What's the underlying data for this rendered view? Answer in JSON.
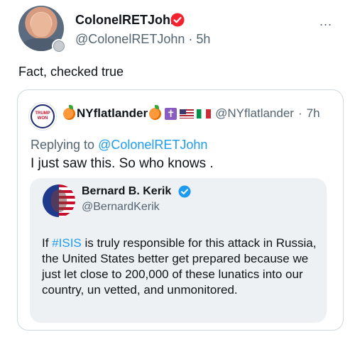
{
  "author": {
    "display_name": "ColonelRETJohn",
    "handle": "@ColonelRETJohn",
    "time": "5h",
    "verified_icon_color": "#f4212e",
    "more_icon": "..."
  },
  "tweet": {
    "text": "Fact, checked true"
  },
  "quoted": {
    "avatar_text": "TRUMP WON",
    "display_name": "NYflatlander",
    "cross_glyph": "✝",
    "handle": "@NYflatlander",
    "time": "7h",
    "replying_prefix": "Replying to",
    "replying_mention": "@ColonelRETJohn",
    "text": "I just saw this. So who knows ."
  },
  "nested_quote": {
    "display_name": "Bernard B. Kerik",
    "handle": "@BernardKerik",
    "verified_icon_color": "#1d9bf0",
    "text_before": "If ",
    "hashtag": "#ISIS",
    "text_after": " is truly responsible for this attack in Russia, the United States better get prepared because we just let close to 200,000 of these lunatics into our country, un vetted, and unmonitored."
  },
  "colors": {
    "link": "#1d9bf0",
    "secondary_text": "#536471",
    "border": "#cfd9de",
    "nested_bg": "#eef1f3"
  }
}
